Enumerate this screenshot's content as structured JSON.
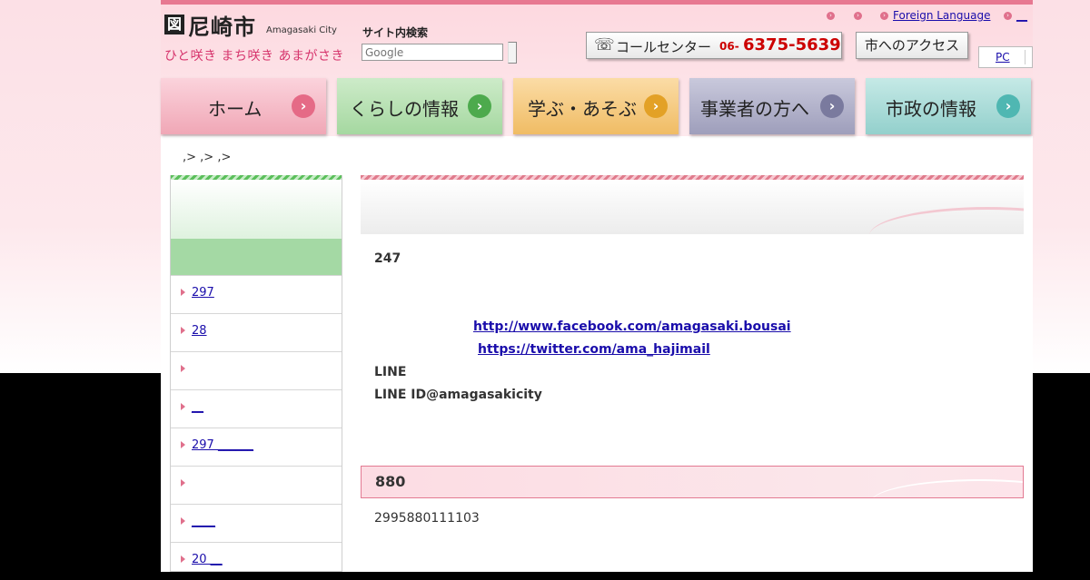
{
  "header": {
    "logo_mark": "図",
    "city_name": "尼崎市",
    "city_name_en": "Amagasaki City",
    "slogan": "ひと咲き まち咲き あまがさき",
    "search_label": "サイト内検索",
    "search_placeholder": "Google",
    "top_links": {
      "foreign_language": "Foreign Language",
      "link_last": "__"
    },
    "call_center": {
      "label": "コールセンター",
      "prefix": "06-",
      "number": "6375-5639"
    },
    "access_button": "市へのアクセス",
    "pc_label": "PC"
  },
  "nav": [
    {
      "label": "ホーム",
      "color": "#e56a86"
    },
    {
      "label": "くらしの情報",
      "color": "#4daa4d"
    },
    {
      "label": "学ぶ・あそぶ",
      "color": "#e3a126"
    },
    {
      "label": "事業者の方へ",
      "color": "#7a7a9e"
    },
    {
      "label": "市政の情報",
      "color": "#4fb7b2"
    }
  ],
  "breadcrumb": ",> ,> ,>",
  "sidebar": {
    "items": [
      "297",
      "28",
      "",
      "__",
      "297 ______",
      "",
      "____",
      "20 __"
    ]
  },
  "main": {
    "line_247": "247",
    "facebook_url": "http://www.facebook.com/amagasaki.bousai",
    "twitter_url": "https://twitter.com/ama_hajimail",
    "line_label": "LINE",
    "line_id": "LINE ID@amagasakicity",
    "section_title": "880",
    "section_text": "2995880111103"
  }
}
